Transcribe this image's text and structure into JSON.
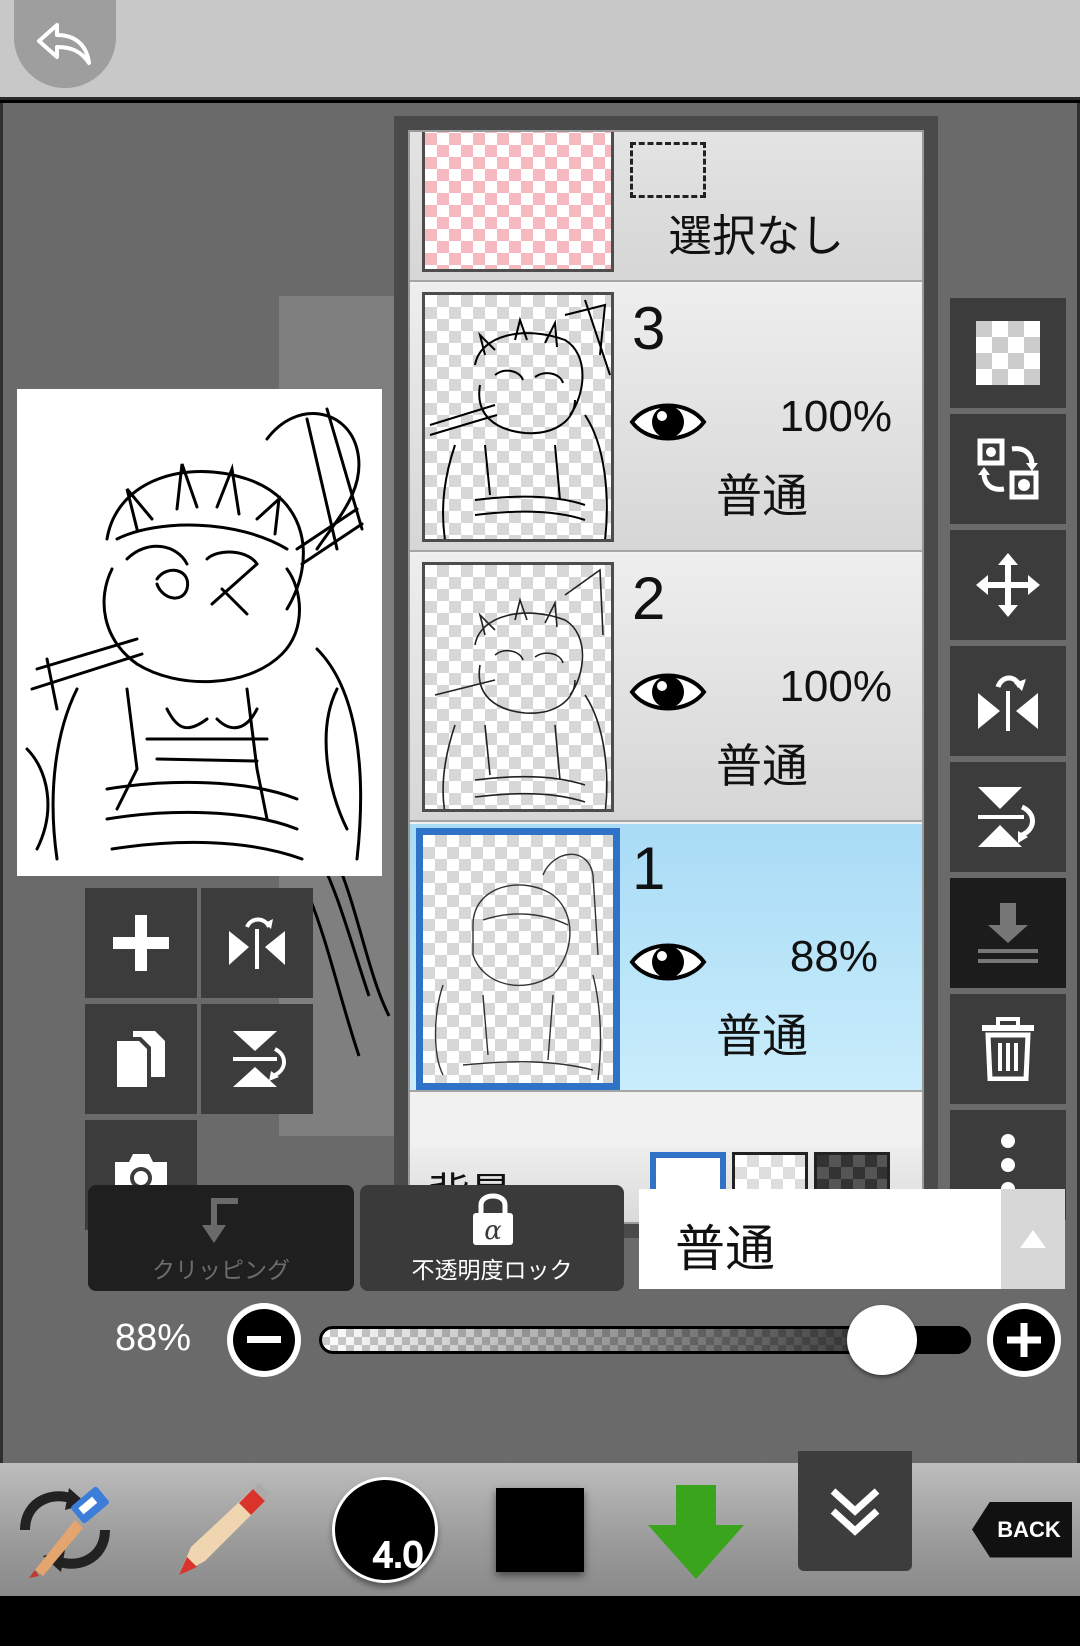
{
  "topbar": {
    "undo_icon": "undo-icon"
  },
  "layers": {
    "selection_layer": {
      "label": "選択なし"
    },
    "items": [
      {
        "number": "3",
        "opacity": "100%",
        "blend": "普通",
        "selected": false
      },
      {
        "number": "2",
        "opacity": "100%",
        "blend": "普通",
        "selected": false
      },
      {
        "number": "1",
        "opacity": "88%",
        "blend": "普通",
        "selected": true
      }
    ],
    "background": {
      "label": "背景",
      "options": [
        "white",
        "transparent",
        "dark"
      ],
      "selected": "white"
    }
  },
  "controls": {
    "clipping_label": "クリッピング",
    "alpha_lock_label": "不透明度ロック",
    "blend_mode": "普通",
    "opacity_label": "88%",
    "opacity_value": 0.88
  },
  "bottom": {
    "brush_size": "4.0",
    "color": "#000000",
    "back_label": "BACK"
  },
  "colors": {
    "selected_layer": "#bfe6f9",
    "accent_blue": "#2f73c9",
    "download_green": "#3aa51c"
  }
}
